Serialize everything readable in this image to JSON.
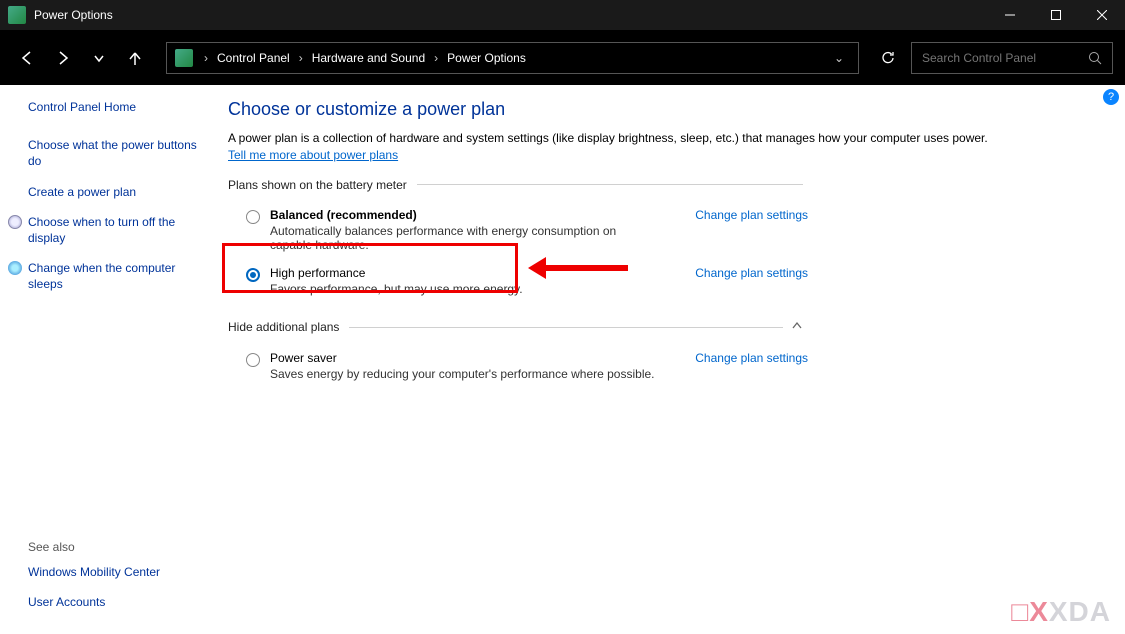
{
  "window": {
    "title": "Power Options"
  },
  "breadcrumb": [
    "Control Panel",
    "Hardware and Sound",
    "Power Options"
  ],
  "search": {
    "placeholder": "Search Control Panel"
  },
  "sidebar": {
    "home": "Control Panel Home",
    "links": [
      "Choose what the power buttons do",
      "Create a power plan",
      "Choose when to turn off the display",
      "Change when the computer sleeps"
    ]
  },
  "see_also": {
    "heading": "See also",
    "links": [
      "Windows Mobility Center",
      "User Accounts"
    ]
  },
  "main": {
    "title": "Choose or customize a power plan",
    "description_pre": "A power plan is a collection of hardware and system settings (like display brightness, sleep, etc.) that manages how your computer uses power. ",
    "description_link": "Tell me more about power plans",
    "section1": "Plans shown on the battery meter",
    "section2": "Hide additional plans",
    "change_link": "Change plan settings",
    "plans": [
      {
        "name": "Balanced (recommended)",
        "desc": "Automatically balances performance with energy consumption on capable hardware.",
        "selected": false,
        "bold": true
      },
      {
        "name": "High performance",
        "desc": "Favors performance, but may use more energy.",
        "selected": true,
        "bold": false
      }
    ],
    "additional_plans": [
      {
        "name": "Power saver",
        "desc": "Saves energy by reducing your computer's performance where possible.",
        "selected": false
      }
    ]
  },
  "watermark": "XDA"
}
